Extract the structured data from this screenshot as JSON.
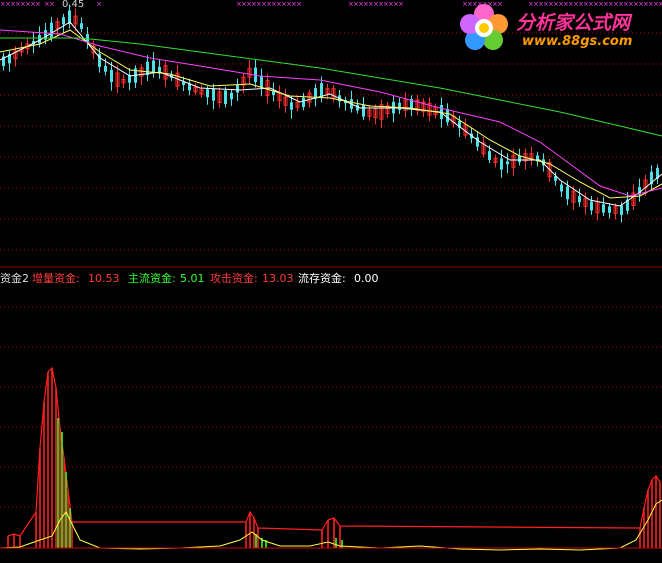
{
  "watermark": {
    "title": "分析家公式网",
    "url": "www.88gs.com",
    "logo_icon": "flower-logo-icon"
  },
  "top_panel": {
    "price_label": "0.45",
    "grid_levels": 8
  },
  "legend": {
    "indicator_name": "资金2",
    "items": [
      {
        "label": "增量资金:",
        "value": "10.53",
        "color": "#ff3b3b"
      },
      {
        "label": "主流资金:",
        "value": "5.01",
        "color": "#33ff33"
      },
      {
        "label": "攻击资金:",
        "value": "13.03",
        "color": "#ff3b3b"
      },
      {
        "label": "流存资金:",
        "value": "0.00",
        "color": "#ffffff"
      }
    ]
  },
  "colors": {
    "up": "#ff3030",
    "down": "#4fe0e8",
    "ma_short": "#ffffff",
    "ma_mid": "#ffff66",
    "ma_long1": "#ff40ff",
    "ma_long2": "#33dd33",
    "grid": "#b00000",
    "flow_line": "#ffff44"
  },
  "chart_data": [
    {
      "type": "candlestick",
      "description_hint": "price candles with moving averages",
      "trend_points": [
        [
          0,
          62
        ],
        [
          10,
          58
        ],
        [
          20,
          50
        ],
        [
          30,
          44
        ],
        [
          40,
          38
        ],
        [
          50,
          30
        ],
        [
          60,
          22
        ],
        [
          70,
          16
        ],
        [
          80,
          26
        ],
        [
          90,
          46
        ],
        [
          100,
          64
        ],
        [
          110,
          76
        ],
        [
          120,
          82
        ],
        [
          130,
          78
        ],
        [
          140,
          72
        ],
        [
          150,
          66
        ],
        [
          160,
          70
        ],
        [
          170,
          76
        ],
        [
          180,
          82
        ],
        [
          190,
          88
        ],
        [
          200,
          92
        ],
        [
          210,
          94
        ],
        [
          220,
          98
        ],
        [
          230,
          96
        ],
        [
          240,
          84
        ],
        [
          250,
          70
        ],
        [
          260,
          82
        ],
        [
          270,
          92
        ],
        [
          280,
          98
        ],
        [
          290,
          106
        ],
        [
          300,
          104
        ],
        [
          310,
          96
        ],
        [
          320,
          90
        ],
        [
          330,
          92
        ],
        [
          340,
          100
        ],
        [
          350,
          104
        ],
        [
          360,
          110
        ],
        [
          370,
          114
        ],
        [
          380,
          112
        ],
        [
          390,
          108
        ],
        [
          400,
          106
        ],
        [
          410,
          104
        ],
        [
          420,
          106
        ],
        [
          430,
          110
        ],
        [
          440,
          112
        ],
        [
          450,
          118
        ],
        [
          460,
          126
        ],
        [
          470,
          136
        ],
        [
          480,
          146
        ],
        [
          490,
          158
        ],
        [
          500,
          164
        ],
        [
          510,
          162
        ],
        [
          520,
          158
        ],
        [
          530,
          156
        ],
        [
          540,
          160
        ],
        [
          550,
          172
        ],
        [
          560,
          188
        ],
        [
          570,
          196
        ],
        [
          580,
          200
        ],
        [
          590,
          206
        ],
        [
          600,
          208
        ],
        [
          610,
          210
        ],
        [
          620,
          210
        ],
        [
          630,
          202
        ],
        [
          640,
          188
        ],
        [
          650,
          178
        ],
        [
          660,
          170
        ]
      ],
      "ma_lines": [
        {
          "name": "ma5",
          "points": [
            [
              0,
              60
            ],
            [
              40,
              40
            ],
            [
              70,
              22
            ],
            [
              100,
              58
            ],
            [
              130,
              76
            ],
            [
              160,
              72
            ],
            [
              200,
              88
            ],
            [
              240,
              90
            ],
            [
              270,
              88
            ],
            [
              300,
              102
            ],
            [
              330,
              94
            ],
            [
              360,
              108
            ],
            [
              400,
              108
            ],
            [
              440,
              112
            ],
            [
              480,
              142
            ],
            [
              510,
              160
            ],
            [
              540,
              160
            ],
            [
              560,
              180
            ],
            [
              590,
              200
            ],
            [
              620,
              206
            ],
            [
              640,
              192
            ],
            [
              662,
              174
            ]
          ]
        },
        {
          "name": "ma10",
          "points": [
            [
              0,
              52
            ],
            [
              40,
              44
            ],
            [
              70,
              30
            ],
            [
              100,
              52
            ],
            [
              130,
              70
            ],
            [
              170,
              74
            ],
            [
              210,
              86
            ],
            [
              250,
              84
            ],
            [
              290,
              96
            ],
            [
              330,
              98
            ],
            [
              370,
              106
            ],
            [
              410,
              108
            ],
            [
              450,
              114
            ],
            [
              490,
              140
            ],
            [
              520,
              156
            ],
            [
              550,
              164
            ],
            [
              580,
              182
            ],
            [
              610,
              198
            ],
            [
              640,
              196
            ],
            [
              662,
              184
            ]
          ]
        },
        {
          "name": "ma30",
          "points": [
            [
              0,
              30
            ],
            [
              60,
              34
            ],
            [
              100,
              46
            ],
            [
              150,
              58
            ],
            [
              200,
              66
            ],
            [
              260,
              76
            ],
            [
              320,
              80
            ],
            [
              380,
              92
            ],
            [
              440,
              108
            ],
            [
              500,
              122
            ],
            [
              540,
              142
            ],
            [
              570,
              164
            ],
            [
              600,
              186
            ],
            [
              630,
              196
            ],
            [
              662,
              188
            ]
          ]
        },
        {
          "name": "ma60",
          "points": [
            [
              0,
              38
            ],
            [
              80,
              38
            ],
            [
              140,
              44
            ],
            [
              200,
              52
            ],
            [
              260,
              60
            ],
            [
              320,
              68
            ],
            [
              380,
              78
            ],
            [
              440,
              88
            ],
            [
              500,
              100
            ],
            [
              560,
              112
            ],
            [
              620,
              126
            ],
            [
              662,
              136
            ]
          ]
        }
      ]
    },
    {
      "type": "bar",
      "description_hint": "fund flow indicator",
      "baseline": 0,
      "series": [
        {
          "name": "增量资金",
          "values_peak": 10.53
        },
        {
          "name": "主流资金",
          "values_peak": 5.01
        },
        {
          "name": "攻击资金",
          "values_peak": 13.03
        },
        {
          "name": "流存资金",
          "values_peak": 0.0
        }
      ],
      "red_peaks": [
        {
          "x": 8,
          "h": 12
        },
        {
          "x": 14,
          "h": 14
        },
        {
          "x": 20,
          "h": 12
        },
        {
          "x": 36,
          "h": 36
        },
        {
          "x": 40,
          "h": 100
        },
        {
          "x": 44,
          "h": 146
        },
        {
          "x": 48,
          "h": 176
        },
        {
          "x": 52,
          "h": 180
        },
        {
          "x": 56,
          "h": 160
        },
        {
          "x": 60,
          "h": 120
        },
        {
          "x": 64,
          "h": 90
        },
        {
          "x": 68,
          "h": 58
        },
        {
          "x": 72,
          "h": 26
        },
        {
          "x": 246,
          "h": 26
        },
        {
          "x": 250,
          "h": 36
        },
        {
          "x": 254,
          "h": 30
        },
        {
          "x": 258,
          "h": 20
        },
        {
          "x": 322,
          "h": 18
        },
        {
          "x": 328,
          "h": 28
        },
        {
          "x": 334,
          "h": 30
        },
        {
          "x": 340,
          "h": 22
        },
        {
          "x": 640,
          "h": 20
        },
        {
          "x": 644,
          "h": 40
        },
        {
          "x": 648,
          "h": 58
        },
        {
          "x": 652,
          "h": 68
        },
        {
          "x": 656,
          "h": 72
        },
        {
          "x": 660,
          "h": 66
        }
      ],
      "green_peaks": [
        {
          "x": 58,
          "h": 130
        },
        {
          "x": 62,
          "h": 116
        },
        {
          "x": 66,
          "h": 76
        },
        {
          "x": 70,
          "h": 40
        },
        {
          "x": 256,
          "h": 14
        },
        {
          "x": 262,
          "h": 10
        },
        {
          "x": 266,
          "h": 8
        },
        {
          "x": 336,
          "h": 10
        },
        {
          "x": 342,
          "h": 8
        }
      ],
      "flow_line": [
        [
          0,
          548
        ],
        [
          20,
          547
        ],
        [
          40,
          540
        ],
        [
          52,
          536
        ],
        [
          60,
          520
        ],
        [
          66,
          512
        ],
        [
          72,
          524
        ],
        [
          80,
          540
        ],
        [
          100,
          548
        ],
        [
          140,
          549
        ],
        [
          180,
          548
        ],
        [
          220,
          546
        ],
        [
          240,
          540
        ],
        [
          252,
          532
        ],
        [
          262,
          540
        ],
        [
          280,
          546
        ],
        [
          310,
          546
        ],
        [
          328,
          542
        ],
        [
          340,
          546
        ],
        [
          380,
          548
        ],
        [
          420,
          546
        ],
        [
          460,
          549
        ],
        [
          500,
          550
        ],
        [
          540,
          549
        ],
        [
          580,
          550
        ],
        [
          620,
          548
        ],
        [
          636,
          540
        ],
        [
          648,
          520
        ],
        [
          656,
          504
        ],
        [
          662,
          500
        ]
      ]
    }
  ]
}
